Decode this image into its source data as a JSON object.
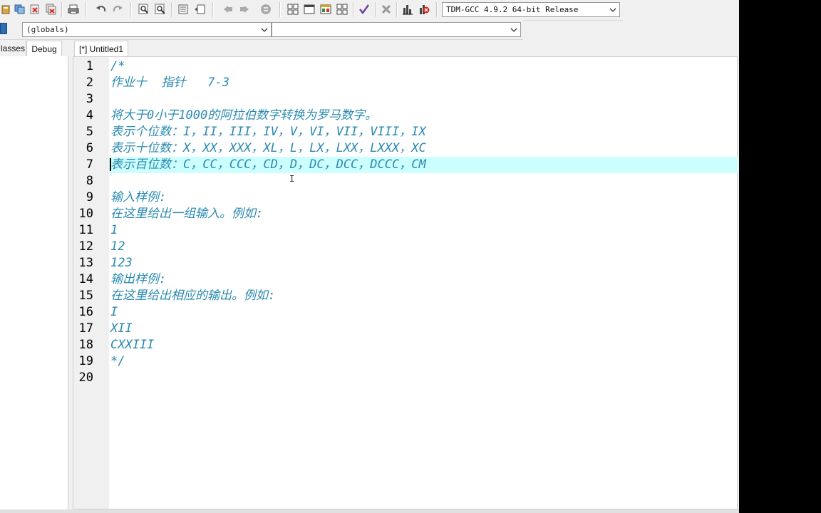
{
  "toolbar": {
    "compiler": "TDM-GCC 4.9.2 64-bit Release",
    "icons": [
      "project-icon",
      "save-all-icon",
      "close-icon",
      "close-all-icon",
      "print-icon",
      "undo-icon",
      "redo-icon",
      "find-icon",
      "replace-icon",
      "indent-icon",
      "unindent-icon",
      "back-icon",
      "forward-icon",
      "toggle-icon",
      "new-class-icon",
      "window-icon",
      "layout-icon",
      "grid-icon",
      "check-icon",
      "stop-icon",
      "chart-icon",
      "debug-icon"
    ]
  },
  "scope": {
    "globals": "(globals)",
    "member": ""
  },
  "left_panel": {
    "tabs": [
      "lasses",
      "Debug"
    ],
    "active": "Debug"
  },
  "editor": {
    "tab_label": "[*] Untitled1",
    "current_line": 7,
    "lines": [
      {
        "n": "1",
        "text": "/*"
      },
      {
        "n": "2",
        "text": "作业十  指针   7-3"
      },
      {
        "n": "3",
        "text": ""
      },
      {
        "n": "4",
        "text": "将大于0小于1000的阿拉伯数字转换为罗马数字。"
      },
      {
        "n": "5",
        "text": "表示个位数：I，II，III，IV，V，VI，VII，VIII，IX"
      },
      {
        "n": "6",
        "text": "表示十位数：X，XX，XXX，XL，L，LX，LXX，LXXX，XC"
      },
      {
        "n": "7",
        "text": "表示百位数：C，CC，CCC，CD，D，DC，DCC，DCCC，CM"
      },
      {
        "n": "8",
        "text": ""
      },
      {
        "n": "9",
        "text": "输入样例:"
      },
      {
        "n": "10",
        "text": "在这里给出一组输入。例如:"
      },
      {
        "n": "11",
        "text": "1"
      },
      {
        "n": "12",
        "text": "12"
      },
      {
        "n": "13",
        "text": "123"
      },
      {
        "n": "14",
        "text": "输出样例:"
      },
      {
        "n": "15",
        "text": "在这里给出相应的输出。例如:"
      },
      {
        "n": "16",
        "text": "I"
      },
      {
        "n": "17",
        "text": "XII"
      },
      {
        "n": "18",
        "text": "CXXIII"
      },
      {
        "n": "19",
        "text": "*/"
      },
      {
        "n": "20",
        "text": ""
      }
    ]
  },
  "colors": {
    "comment": "#2a8ab0",
    "current_line": "#ccffff",
    "gutter": "#f0f0f0"
  }
}
